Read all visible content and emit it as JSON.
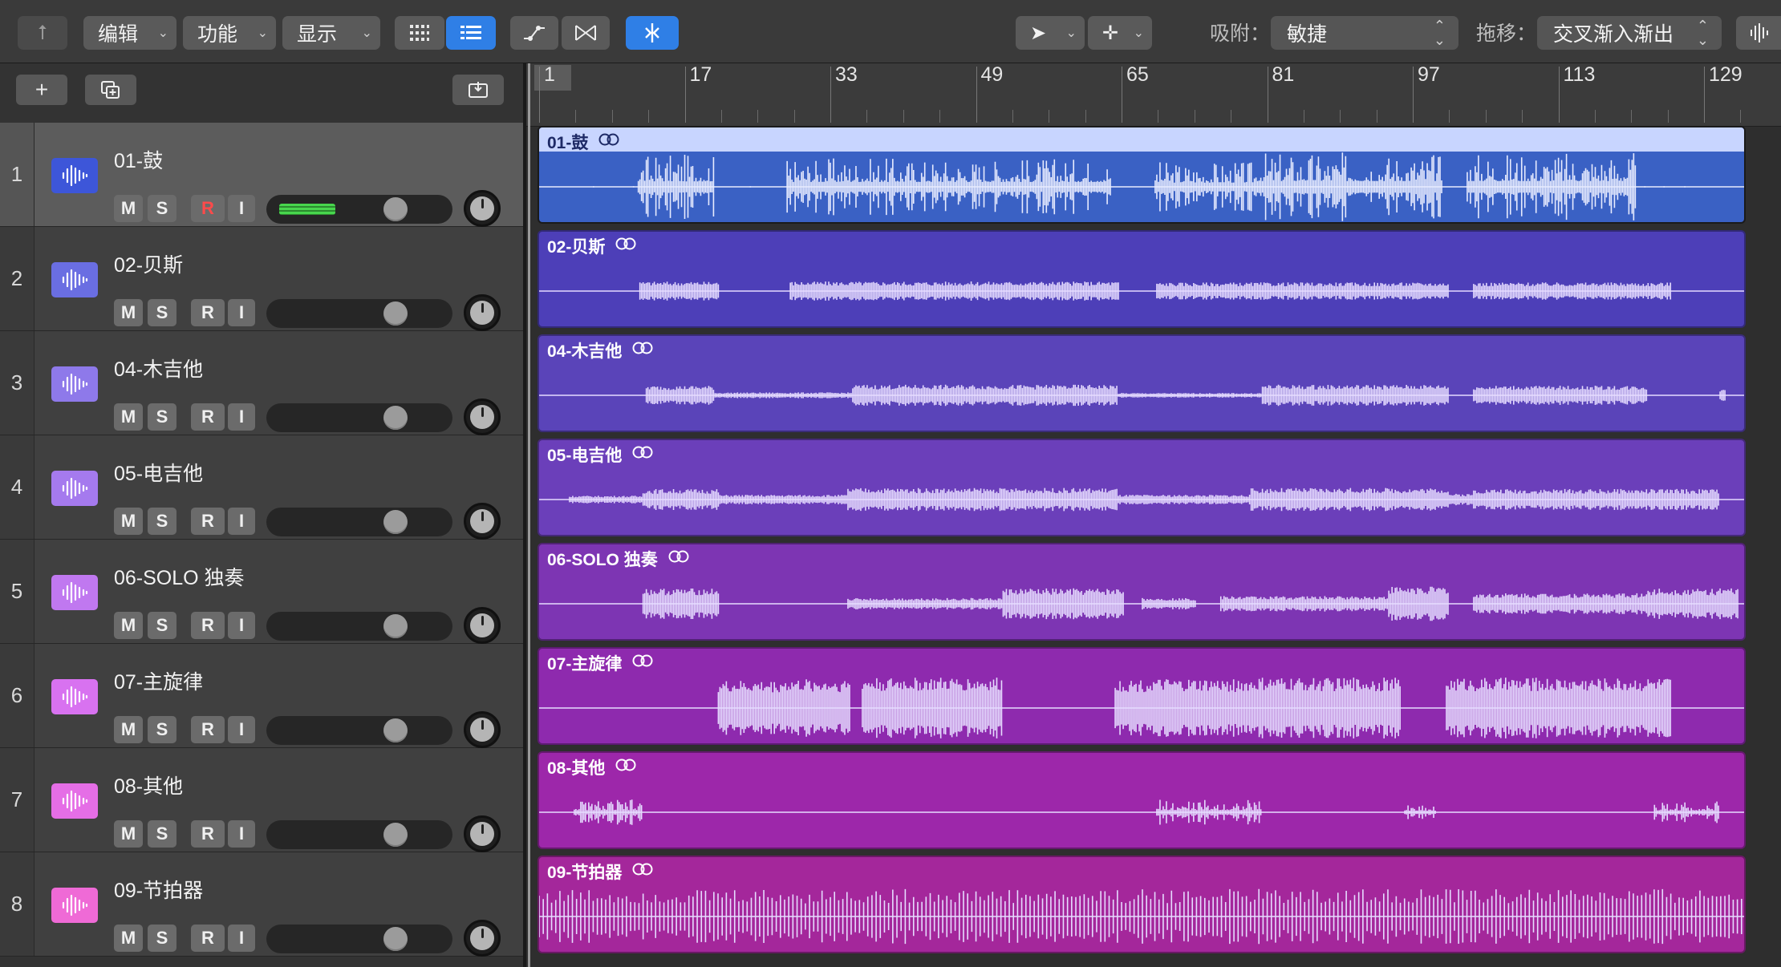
{
  "toolbar": {
    "back_icon": "up-arrow-icon",
    "menus": [
      {
        "label": "编辑"
      },
      {
        "label": "功能"
      },
      {
        "label": "显示"
      }
    ],
    "view_buttons": [
      "grid-view-icon",
      "list-view-icon"
    ],
    "tool_buttons": [
      "automation-curve-icon",
      "flex-icon",
      "catch-playhead-icon"
    ],
    "pointer_tool": "pointer-icon",
    "pencil_tool": "crosshair-icon",
    "snap_label": "吸附：",
    "snap_value": "敏捷",
    "drag_label": "拖移：",
    "drag_value": "交叉渐入渐出",
    "waveform_zoom_icon": "waveform-zoom-icon"
  },
  "header_toolbar": {
    "add_icon": "plus-icon",
    "duplicate_icon": "duplicate-track-icon",
    "catch_icon": "inbox-icon"
  },
  "ruler": {
    "bars": [
      "1",
      "17",
      "33",
      "49",
      "65",
      "81",
      "97",
      "113",
      "129"
    ]
  },
  "tracks": [
    {
      "number": "1",
      "name": "01-鼓",
      "region": "01-鼓",
      "color": "#3d56d9",
      "region_color": "#3a61c4",
      "selected": true,
      "rec_armed": true,
      "volume": 0.75,
      "meter": 0.35,
      "wave": "drums"
    },
    {
      "number": "2",
      "name": "02-贝斯",
      "region": "02-贝斯",
      "color": "#6a6ee2",
      "region_color": "#4d3fb8",
      "selected": false,
      "rec_armed": false,
      "volume": 0.75,
      "meter": 0,
      "wave": "bass"
    },
    {
      "number": "3",
      "name": "04-木吉他",
      "region": "04-木吉他",
      "color": "#8e79ea",
      "region_color": "#5a44b9",
      "selected": false,
      "rec_armed": false,
      "volume": 0.75,
      "meter": 0,
      "wave": "acoustic"
    },
    {
      "number": "4",
      "name": "05-电吉他",
      "region": "05-电吉他",
      "color": "#a57aee",
      "region_color": "#6b3fba",
      "selected": false,
      "rec_armed": false,
      "volume": 0.75,
      "meter": 0,
      "wave": "electric"
    },
    {
      "number": "5",
      "name": "06-SOLO 独奏",
      "region": "06-SOLO 独奏",
      "color": "#c078f0",
      "region_color": "#7d35b3",
      "selected": false,
      "rec_armed": false,
      "volume": 0.75,
      "meter": 0,
      "wave": "solo"
    },
    {
      "number": "6",
      "name": "07-主旋律",
      "region": "07-主旋律",
      "color": "#d872f0",
      "region_color": "#8e2aae",
      "selected": false,
      "rec_armed": false,
      "volume": 0.75,
      "meter": 0,
      "wave": "lead"
    },
    {
      "number": "7",
      "name": "08-其他",
      "region": "08-其他",
      "color": "#e56ee6",
      "region_color": "#9d27aa",
      "selected": false,
      "rec_armed": false,
      "volume": 0.75,
      "meter": 0,
      "wave": "other"
    },
    {
      "number": "8",
      "name": "09-节拍器",
      "region": "09-节拍器",
      "color": "#ef6ad6",
      "region_color": "#a4279b",
      "selected": false,
      "rec_armed": false,
      "volume": 0.75,
      "meter": 0,
      "wave": "click"
    }
  ],
  "track_buttons": {
    "mute": "M",
    "solo": "S",
    "record": "R",
    "input": "I"
  }
}
